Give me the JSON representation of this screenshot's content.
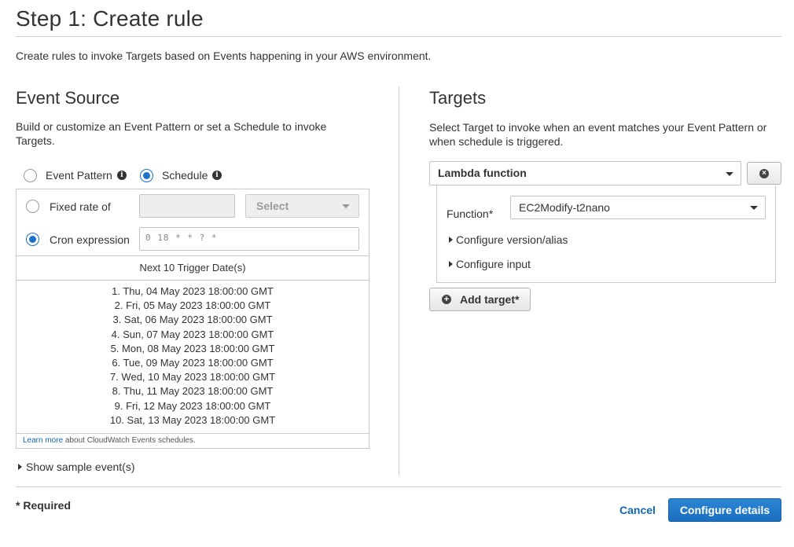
{
  "page": {
    "title": "Step 1: Create rule",
    "intro": "Create rules to invoke Targets based on Events happening in your AWS environment."
  },
  "event_source": {
    "title": "Event Source",
    "description": "Build or customize an Event Pattern or set a Schedule to invoke Targets.",
    "options": [
      {
        "label": "Event Pattern",
        "selected": false
      },
      {
        "label": "Schedule",
        "selected": true
      }
    ],
    "fixed_rate": {
      "label": "Fixed rate of",
      "value": "",
      "unit_placeholder": "Select",
      "selected": false
    },
    "cron": {
      "label": "Cron expression",
      "value": "0 18 * * ? *",
      "selected": true
    },
    "next_dates_header": "Next 10 Trigger Date(s)",
    "next_dates": [
      "1. Thu, 04 May 2023 18:00:00 GMT",
      "2. Fri, 05 May 2023 18:00:00 GMT",
      "3. Sat, 06 May 2023 18:00:00 GMT",
      "4. Sun, 07 May 2023 18:00:00 GMT",
      "5. Mon, 08 May 2023 18:00:00 GMT",
      "6. Tue, 09 May 2023 18:00:00 GMT",
      "7. Wed, 10 May 2023 18:00:00 GMT",
      "8. Thu, 11 May 2023 18:00:00 GMT",
      "9. Fri, 12 May 2023 18:00:00 GMT",
      "10. Sat, 13 May 2023 18:00:00 GMT"
    ],
    "learn_more_link": "Learn more",
    "learn_more_rest": " about CloudWatch Events schedules.",
    "show_sample": "Show sample event(s)"
  },
  "targets": {
    "title": "Targets",
    "description": "Select Target to invoke when an event matches your Event Pattern or when schedule is triggered.",
    "target_type": "Lambda function",
    "function_label": "Function*",
    "function_value": "EC2Modify-t2nano",
    "configure_version": "Configure version/alias",
    "configure_input": "Configure input",
    "add_target": "Add target*"
  },
  "footer": {
    "required": "* Required",
    "cancel": "Cancel",
    "configure_details": "Configure details"
  },
  "colors": {
    "accent": "#1a73c9",
    "link": "#1166bb",
    "primary_button": "#1c6fbf"
  },
  "icons": [
    "info-icon",
    "chevron-down-icon",
    "remove-circle-icon",
    "plus-circle-icon",
    "caret-right-icon"
  ]
}
